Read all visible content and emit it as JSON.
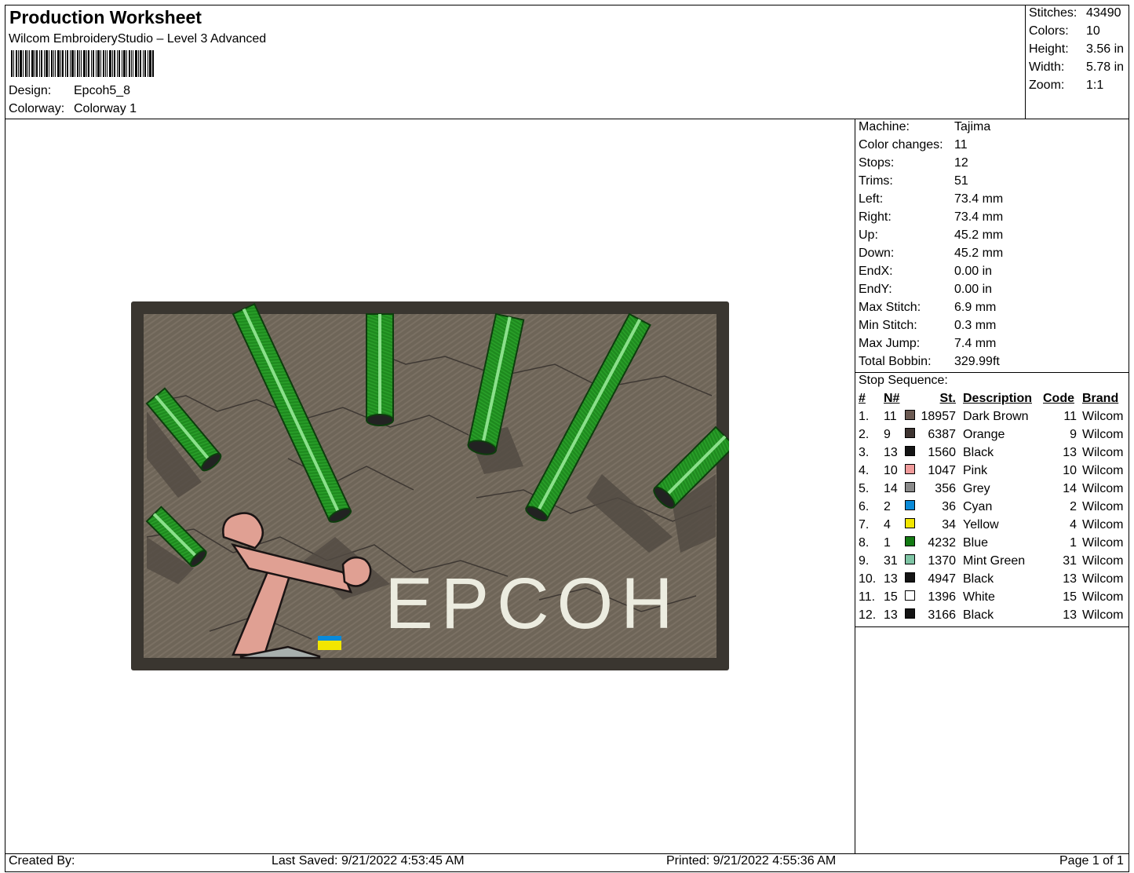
{
  "header": {
    "title": "Production Worksheet",
    "software": "Wilcom EmbroideryStudio – Level 3 Advanced",
    "design_label": "Design:",
    "design_value": "Epcoh5_8",
    "colorway_label": "Colorway:",
    "colorway_value": "Colorway 1"
  },
  "summary": [
    {
      "label": "Stitches:",
      "value": "43490"
    },
    {
      "label": "Colors:",
      "value": "10"
    },
    {
      "label": "Height:",
      "value": "3.56 in"
    },
    {
      "label": "Width:",
      "value": "5.78 in"
    },
    {
      "label": "Zoom:",
      "value": "1:1"
    }
  ],
  "machine_info": [
    {
      "label": "Machine:",
      "value": "Tajima"
    },
    {
      "label": "Color changes:",
      "value": "11"
    },
    {
      "label": "Stops:",
      "value": "12"
    },
    {
      "label": "Trims:",
      "value": "51"
    },
    {
      "label": "Left:",
      "value": "73.4 mm"
    },
    {
      "label": "Right:",
      "value": "73.4 mm"
    },
    {
      "label": "Up:",
      "value": "45.2 mm"
    },
    {
      "label": "Down:",
      "value": "45.2 mm"
    },
    {
      "label": "EndX:",
      "value": "0.00 in"
    },
    {
      "label": "EndY:",
      "value": "0.00 in"
    },
    {
      "label": "Max Stitch:",
      "value": "6.9 mm"
    },
    {
      "label": "Min Stitch:",
      "value": "0.3 mm"
    },
    {
      "label": "Max Jump:",
      "value": "7.4 mm"
    },
    {
      "label": "Total Bobbin:",
      "value": "329.99ft"
    }
  ],
  "stop_sequence": {
    "title": "Stop Sequence:",
    "headers": {
      "num": "#",
      "needle": "N#",
      "stitches": "St.",
      "description": "Description",
      "code": "Code",
      "brand": "Brand"
    },
    "rows": [
      {
        "num": "1.",
        "needle": "11",
        "color": "#6b5a52",
        "stitches": "18957",
        "description": "Dark Brown",
        "code": "11",
        "brand": "Wilcom"
      },
      {
        "num": "2.",
        "needle": "9",
        "color": "#3e3431",
        "stitches": "6387",
        "description": "Orange",
        "code": "9",
        "brand": "Wilcom"
      },
      {
        "num": "3.",
        "needle": "13",
        "color": "#141414",
        "stitches": "1560",
        "description": "Black",
        "code": "13",
        "brand": "Wilcom"
      },
      {
        "num": "4.",
        "needle": "10",
        "color": "#f09a9a",
        "stitches": "1047",
        "description": "Pink",
        "code": "10",
        "brand": "Wilcom"
      },
      {
        "num": "5.",
        "needle": "14",
        "color": "#8a8a8a",
        "stitches": "356",
        "description": "Grey",
        "code": "14",
        "brand": "Wilcom"
      },
      {
        "num": "6.",
        "needle": "2",
        "color": "#0a8ad8",
        "stitches": "36",
        "description": "Cyan",
        "code": "2",
        "brand": "Wilcom"
      },
      {
        "num": "7.",
        "needle": "4",
        "color": "#f2e600",
        "stitches": "34",
        "description": "Yellow",
        "code": "4",
        "brand": "Wilcom"
      },
      {
        "num": "8.",
        "needle": "1",
        "color": "#137a13",
        "stitches": "4232",
        "description": "Blue",
        "code": "1",
        "brand": "Wilcom"
      },
      {
        "num": "9.",
        "needle": "31",
        "color": "#7ec4a4",
        "stitches": "1370",
        "description": "Mint Green",
        "code": "31",
        "brand": "Wilcom"
      },
      {
        "num": "10.",
        "needle": "13",
        "color": "#141414",
        "stitches": "4947",
        "description": "Black",
        "code": "13",
        "brand": "Wilcom"
      },
      {
        "num": "11.",
        "needle": "15",
        "color": "#ffffff",
        "stitches": "1396",
        "description": "White",
        "code": "15",
        "brand": "Wilcom"
      },
      {
        "num": "12.",
        "needle": "13",
        "color": "#141414",
        "stitches": "3166",
        "description": "Black",
        "code": "13",
        "brand": "Wilcom"
      }
    ]
  },
  "design_preview": {
    "text": "EPCOH",
    "colors": {
      "border": "#3a3630",
      "background": "#6e6558",
      "tube": "#1f8a1f",
      "tube_highlight": "#8be08b",
      "skin": "#e0a093",
      "lettering": "#ecece0"
    }
  },
  "footer": {
    "created_by": "Created By:",
    "last_saved": "Last Saved: 9/21/2022 4:53:45 AM",
    "printed": "Printed: 9/21/2022 4:55:36 AM",
    "page": "Page 1 of 1"
  }
}
